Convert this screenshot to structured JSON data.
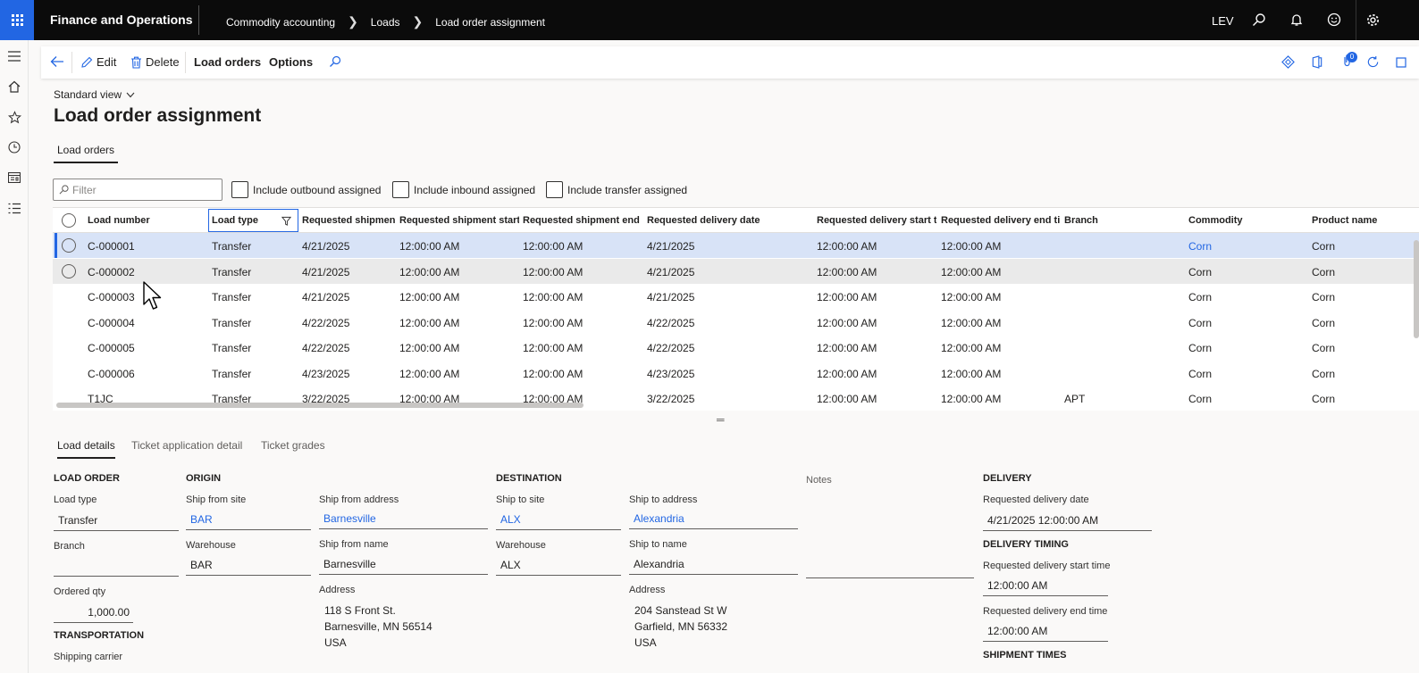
{
  "topbar": {
    "app_name": "Finance and Operations",
    "breadcrumb": [
      "Commodity accounting",
      "Loads",
      "Load order assignment"
    ],
    "company": "LEV",
    "icons": [
      "search-icon",
      "bell-icon",
      "smiley-icon",
      "gear-icon"
    ]
  },
  "leftnav": [
    "hamburger-icon",
    "home-icon",
    "star-icon",
    "clock-icon",
    "workspace-icon",
    "list-icon"
  ],
  "actionpane": {
    "edit": "Edit",
    "delete": "Delete",
    "load_orders": "Load orders",
    "options": "Options",
    "badge_count": "0"
  },
  "page": {
    "view": "Standard view",
    "title": "Load order assignment",
    "tab": "Load orders"
  },
  "filters": {
    "filter_placeholder": "Filter",
    "include_outbound": "Include outbound assigned",
    "include_inbound": "Include inbound assigned",
    "include_transfer": "Include transfer assigned"
  },
  "grid": {
    "columns": [
      "Load number",
      "Load type",
      "Requested shipmen...",
      "Requested shipment start...",
      "Requested shipment end ...",
      "Requested delivery date",
      "Requested delivery start t...",
      "Requested delivery end ti...",
      "Branch",
      "Commodity",
      "Product name"
    ],
    "rows": [
      [
        "C-000001",
        "Transfer",
        "4/21/2025",
        "12:00:00 AM",
        "12:00:00 AM",
        "4/21/2025",
        "12:00:00 AM",
        "12:00:00 AM",
        "",
        "Corn",
        "Corn"
      ],
      [
        "C-000002",
        "Transfer",
        "4/21/2025",
        "12:00:00 AM",
        "12:00:00 AM",
        "4/21/2025",
        "12:00:00 AM",
        "12:00:00 AM",
        "",
        "Corn",
        "Corn"
      ],
      [
        "C-000003",
        "Transfer",
        "4/21/2025",
        "12:00:00 AM",
        "12:00:00 AM",
        "4/21/2025",
        "12:00:00 AM",
        "12:00:00 AM",
        "",
        "Corn",
        "Corn"
      ],
      [
        "C-000004",
        "Transfer",
        "4/22/2025",
        "12:00:00 AM",
        "12:00:00 AM",
        "4/22/2025",
        "12:00:00 AM",
        "12:00:00 AM",
        "",
        "Corn",
        "Corn"
      ],
      [
        "C-000005",
        "Transfer",
        "4/22/2025",
        "12:00:00 AM",
        "12:00:00 AM",
        "4/22/2025",
        "12:00:00 AM",
        "12:00:00 AM",
        "",
        "Corn",
        "Corn"
      ],
      [
        "C-000006",
        "Transfer",
        "4/23/2025",
        "12:00:00 AM",
        "12:00:00 AM",
        "4/23/2025",
        "12:00:00 AM",
        "12:00:00 AM",
        "",
        "Corn",
        "Corn"
      ],
      [
        "T1JC",
        "Transfer",
        "3/22/2025",
        "12:00:00 AM",
        "12:00:00 AM",
        "3/22/2025",
        "12:00:00 AM",
        "12:00:00 AM",
        "APT",
        "Corn",
        "Corn"
      ]
    ]
  },
  "detail_tabs": [
    "Load details",
    "Ticket application detail",
    "Ticket grades"
  ],
  "details": {
    "load_order": {
      "heading": "LOAD ORDER",
      "load_type_label": "Load type",
      "load_type": "Transfer",
      "branch_label": "Branch",
      "branch": "",
      "ordered_qty_label": "Ordered qty",
      "ordered_qty": "1,000.00"
    },
    "transportation": {
      "heading": "TRANSPORTATION",
      "shipping_carrier_label": "Shipping carrier"
    },
    "origin": {
      "heading": "ORIGIN",
      "ship_from_site_label": "Ship from site",
      "ship_from_site": "BAR",
      "warehouse_label": "Warehouse",
      "warehouse": "BAR",
      "ship_from_address_label": "Ship from address",
      "ship_from_address": "Barnesville",
      "ship_from_name_label": "Ship from name",
      "ship_from_name": "Barnesville",
      "address_label": "Address",
      "address_lines": [
        "118 S Front St.",
        "Barnesville, MN 56514",
        "USA"
      ]
    },
    "destination": {
      "heading": "DESTINATION",
      "ship_to_site_label": "Ship to site",
      "ship_to_site": "ALX",
      "warehouse_label": "Warehouse",
      "warehouse": "ALX",
      "ship_to_address_label": "Ship to address",
      "ship_to_address": "Alexandria",
      "ship_to_name_label": "Ship to name",
      "ship_to_name": "Alexandria",
      "address_label": "Address",
      "address_lines": [
        "204 Sanstead St W",
        "Garfield, MN 56332",
        "USA"
      ]
    },
    "notes_label": "Notes",
    "delivery": {
      "heading": "DELIVERY",
      "req_date_label": "Requested delivery date",
      "req_date": "4/21/2025 12:00:00 AM",
      "timing_heading": "DELIVERY TIMING",
      "start_label": "Requested delivery start time",
      "start": "12:00:00 AM",
      "end_label": "Requested delivery end time",
      "end": "12:00:00 AM",
      "shipment_times_heading": "SHIPMENT TIMES"
    }
  },
  "colors": {
    "accent": "#2266e3",
    "topbar": "#0b0b0b",
    "selected_row": "#d8e3f7"
  }
}
